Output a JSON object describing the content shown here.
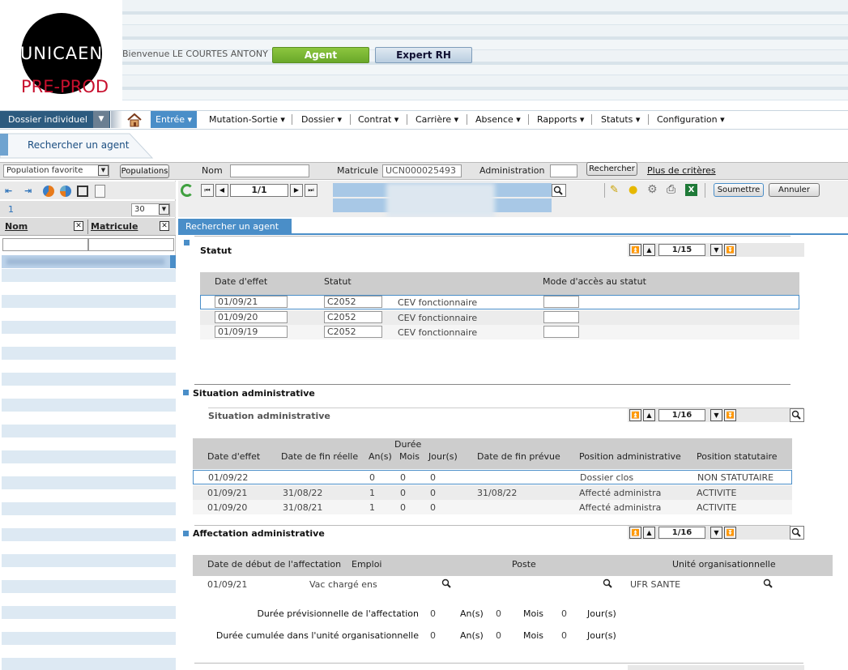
{
  "header": {
    "logo_text": "UNICAEN",
    "env_label": "PRE-PROD",
    "welcome": "Bienvenue LE COURTES ANTONY",
    "role_agent": "Agent",
    "role_expert": "Expert RH"
  },
  "menu": {
    "dossier_label": "Dossier individuel",
    "items": [
      "Entrée",
      "Mutation-Sortie",
      "Dossier",
      "Contrat",
      "Carrière",
      "Absence",
      "Rapports",
      "Statuts",
      "Configuration"
    ]
  },
  "subheader": {
    "title": "Rechercher un agent"
  },
  "search": {
    "population": "Population favorite",
    "populations_btn": "Populations",
    "nom_label": "Nom",
    "nom_value": "",
    "matricule_label": "Matricule",
    "matricule_value": "UCN000025493",
    "administration_label": "Administration",
    "administration_value": "",
    "search_btn": "Rechercher",
    "more_criteria": "Plus de critères"
  },
  "left_panel": {
    "count": "1",
    "page_size": "30",
    "col_nom": "Nom",
    "col_matricule": "Matricule"
  },
  "toolbar": {
    "pager": "1/1",
    "submit": "Soumettre",
    "cancel": "Annuler"
  },
  "content_tab": "Rechercher un agent",
  "statut": {
    "title": "Statut",
    "pager": "1/15",
    "headers": [
      "Date d'effet",
      "Statut",
      "Mode d'accès au statut"
    ],
    "rows": [
      {
        "date": "01/09/21",
        "code": "C2052",
        "label": "CEV fonctionnaire",
        "mode": ""
      },
      {
        "date": "01/09/20",
        "code": "C2052",
        "label": "CEV fonctionnaire",
        "mode": ""
      },
      {
        "date": "01/09/19",
        "code": "C2052",
        "label": "CEV fonctionnaire",
        "mode": ""
      }
    ]
  },
  "situation": {
    "section_title": "Situation administrative",
    "sub_title": "Situation administrative",
    "pager": "1/16",
    "duree_label": "Durée",
    "headers": [
      "Date d'effet",
      "Date de fin réelle",
      "An(s)",
      "Mois",
      "Jour(s)",
      "Date de fin prévue",
      "Position administrative",
      "Position statutaire"
    ],
    "rows": [
      {
        "date": "01/09/22",
        "fin": "",
        "ans": "0",
        "mois": "0",
        "jours": "0",
        "fin_prevue": "",
        "pos_admin": "Dossier clos",
        "pos_stat": "NON STATUTAIRE"
      },
      {
        "date": "01/09/21",
        "fin": "31/08/22",
        "ans": "1",
        "mois": "0",
        "jours": "0",
        "fin_prevue": "31/08/22",
        "pos_admin": "Affecté administra",
        "pos_stat": "ACTIVITE"
      },
      {
        "date": "01/09/20",
        "fin": "31/08/21",
        "ans": "1",
        "mois": "0",
        "jours": "0",
        "fin_prevue": "",
        "pos_admin": "Affecté administra",
        "pos_stat": "ACTIVITE"
      }
    ]
  },
  "affectation": {
    "title": "Affectation administrative",
    "pager": "1/16",
    "headers": [
      "Date de début de l'affectation",
      "Emploi",
      "Poste",
      "Unité organisationnelle"
    ],
    "row": {
      "date": "01/09/21",
      "emploi": "Vac chargé ens",
      "poste": "",
      "unite": "UFR SANTE"
    },
    "duree_prev_label": "Durée prévisionnelle de l'affectation",
    "duree_prev": {
      "ans": "0",
      "mois": "0",
      "jours": "0"
    },
    "duree_cumul_label": "Durée cumulée dans l'unité organisationnelle",
    "duree_cumul": {
      "ans": "0",
      "mois": "0",
      "jours": "0"
    },
    "unit_ans": "An(s)",
    "unit_mois": "Mois",
    "unit_jours": "Jour(s)"
  },
  "colors": {
    "accent": "#4a8ec8",
    "agent_green": "#7ab632",
    "brand_red": "#c8102e"
  }
}
